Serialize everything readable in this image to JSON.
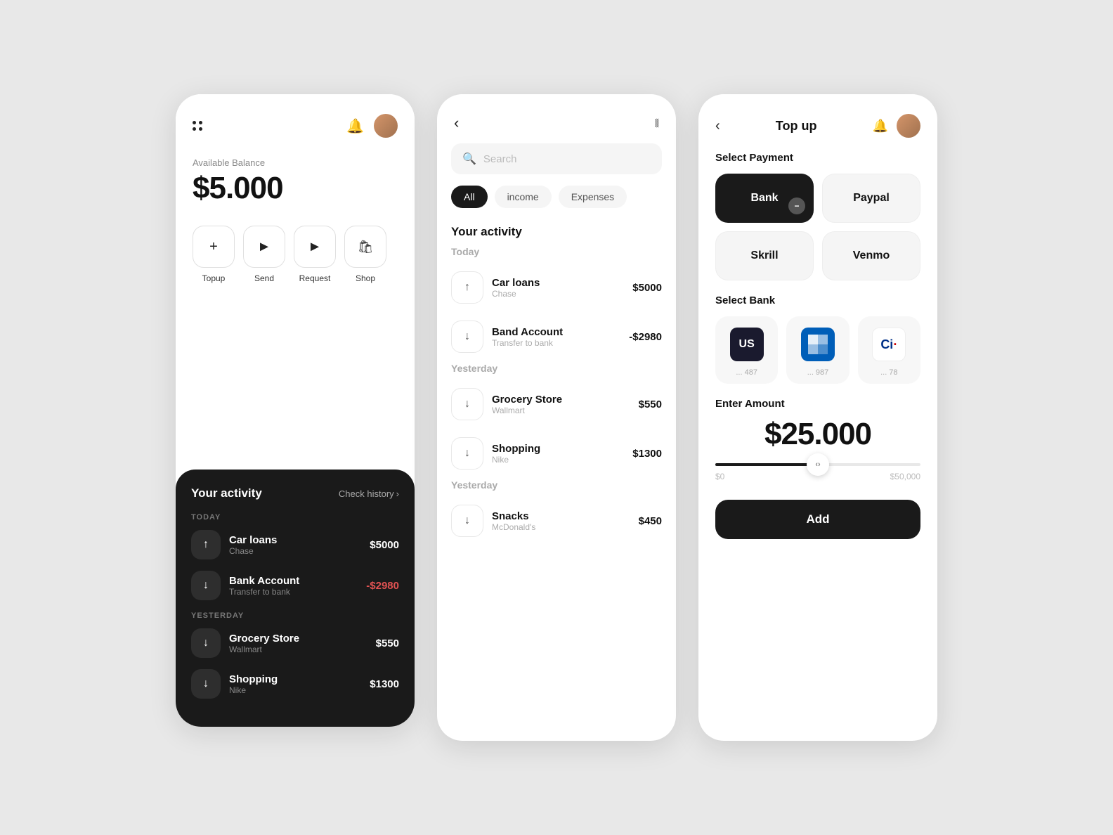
{
  "bg": "#e8e8e8",
  "screen1": {
    "balance_label": "Available Balance",
    "balance_amount": "$5.000",
    "actions": [
      {
        "label": "Topup",
        "icon": "+"
      },
      {
        "label": "Send",
        "icon": "▶"
      },
      {
        "label": "Request",
        "icon": "▶"
      },
      {
        "label": "Shop",
        "icon": "🛍"
      }
    ],
    "activity_title": "Your activity",
    "check_history": "Check history",
    "today_label": "TODAY",
    "yesterday_label": "YESTERDAY",
    "transactions": [
      {
        "name": "Car loans",
        "sub": "Chase",
        "amount": "$5000",
        "type": "positive",
        "icon": "↑"
      },
      {
        "name": "Bank Account",
        "sub": "Transfer to bank",
        "amount": "-$2980",
        "type": "negative",
        "icon": "↓"
      },
      {
        "name": "Grocery Store",
        "sub": "Wallmart",
        "amount": "$550",
        "type": "positive",
        "icon": "↓"
      },
      {
        "name": "Shopping",
        "sub": "Nike",
        "amount": "$1300",
        "type": "positive",
        "icon": "↓"
      }
    ]
  },
  "screen2": {
    "search_placeholder": "Search",
    "activity_title": "Your activity",
    "filter_tabs": [
      {
        "label": "All",
        "active": true
      },
      {
        "label": "income",
        "active": false
      },
      {
        "label": "Expenses",
        "active": false
      }
    ],
    "sections": [
      {
        "label": "Today",
        "items": [
          {
            "name": "Car loans",
            "sub": "Chase",
            "amount": "$5000",
            "icon": "↑"
          },
          {
            "name": "Band Account",
            "sub": "Transfer to bank",
            "amount": "-$2980",
            "icon": "↓"
          }
        ]
      },
      {
        "label": "Yesterday",
        "items": [
          {
            "name": "Grocery Store",
            "sub": "Wallmart",
            "amount": "$550",
            "icon": "↓"
          },
          {
            "name": "Shopping",
            "sub": "Nike",
            "amount": "$1300",
            "icon": "↓"
          }
        ]
      },
      {
        "label": "Yesterday",
        "items": [
          {
            "name": "Snacks",
            "sub": "McDonald's",
            "amount": "$450",
            "icon": "↓"
          }
        ]
      }
    ]
  },
  "screen3": {
    "title": "Top up",
    "select_payment_label": "Select Payment",
    "payment_options": [
      {
        "label": "Bank",
        "selected": true
      },
      {
        "label": "Paypal",
        "selected": false
      },
      {
        "label": "Skrill",
        "selected": false
      },
      {
        "label": "Venmo",
        "selected": false
      }
    ],
    "select_bank_label": "Select Bank",
    "banks": [
      {
        "name": "US Bank",
        "code": "US",
        "dots": "... 487"
      },
      {
        "name": "Chase",
        "code": "Chase",
        "dots": "... 987"
      },
      {
        "name": "Citi",
        "code": "Ci",
        "dots": "... 78"
      }
    ],
    "enter_amount_label": "Enter  Amount",
    "amount": "$25.000",
    "slider_min": "$0",
    "slider_max": "$50,000",
    "add_label": "Add"
  }
}
